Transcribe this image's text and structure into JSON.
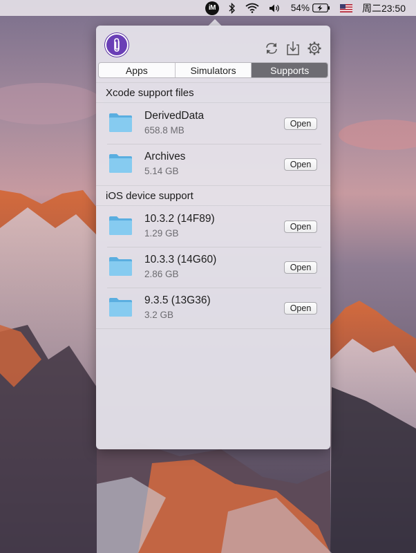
{
  "menubar": {
    "app_icon_text": "iM",
    "battery_percent": "54%",
    "clock": "周二23:50",
    "icons": [
      "bluetooth-icon",
      "wifi-icon",
      "volume-icon",
      "battery-charging-icon",
      "us-flag-icon"
    ]
  },
  "popover": {
    "tabs": [
      {
        "label": "Apps",
        "active": false
      },
      {
        "label": "Simulators",
        "active": false
      },
      {
        "label": "Supports",
        "active": true
      }
    ],
    "toolbar_icons": [
      "refresh-icon",
      "download-icon",
      "gear-icon"
    ],
    "sections": [
      {
        "title": "Xcode support files",
        "items": [
          {
            "name": "DerivedData",
            "size": "658.8 MB",
            "button": "Open"
          },
          {
            "name": "Archives",
            "size": "5.14 GB",
            "button": "Open"
          }
        ]
      },
      {
        "title": "iOS device support",
        "items": [
          {
            "name": "10.3.2 (14F89)",
            "size": "1.29 GB",
            "button": "Open"
          },
          {
            "name": "10.3.3 (14G60)",
            "size": "2.86 GB",
            "button": "Open"
          },
          {
            "name": "9.3.5 (13G36)",
            "size": "3.2 GB",
            "button": "Open"
          }
        ]
      }
    ],
    "colors": {
      "accent": "#6a3fb6",
      "folder": "#7cc3ea",
      "active_tab": "#6d6c72"
    }
  }
}
